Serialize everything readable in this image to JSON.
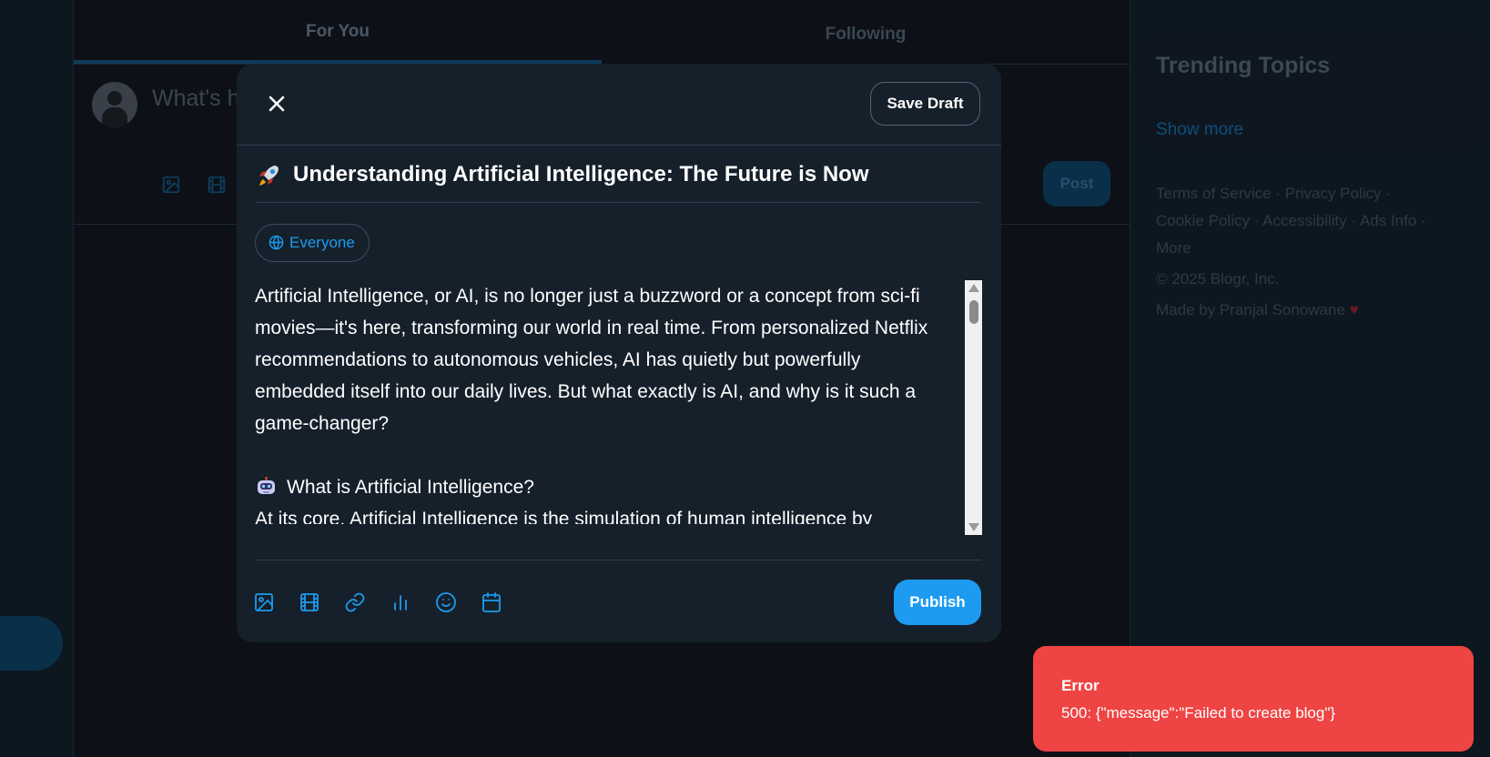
{
  "feed": {
    "tabs": [
      "For You",
      "Following"
    ],
    "composer_placeholder": "What's h",
    "post_label": "Post"
  },
  "sidebar": {
    "trending_title": "Trending Topics",
    "show_more": "Show more",
    "footer_links": [
      "Terms of Service ·",
      "Privacy Policy ·",
      "Cookie Policy ·",
      "Accessibility ·",
      "Ads Info ·",
      "More"
    ],
    "copyright": "© 2025 Blogr, Inc.",
    "made_by": "Made by Pranjal Sonowane"
  },
  "modal": {
    "save_draft": "Save Draft",
    "title": "Understanding Artificial Intelligence: The Future is Now",
    "title_emoji": "rocket-emoji",
    "audience": "Everyone",
    "body_paragraph_1": "Artificial Intelligence, or AI, is no longer just a buzzword or a concept from sci-fi movies—it's here, transforming our world in real time. From personalized Netflix recommendations to autonomous vehicles, AI has quietly but powerfully embedded itself into our daily lives. But what exactly is AI, and why is it such a game-changer?",
    "body_heading": "What is Artificial Intelligence?",
    "body_paragraph_2": "At its core, Artificial Intelligence is the simulation of human intelligence by",
    "toolbar_icons": [
      "image-icon",
      "video-icon",
      "link-icon",
      "poll-icon",
      "emoji-icon",
      "schedule-icon"
    ],
    "publish_label": "Publish"
  },
  "toast": {
    "title": "Error",
    "message": "500: {\"message\":\"Failed to create blog\"}",
    "color": "#ef4444"
  },
  "colors": {
    "accent": "#1d9bf0",
    "modal_bg": "#15202b"
  }
}
